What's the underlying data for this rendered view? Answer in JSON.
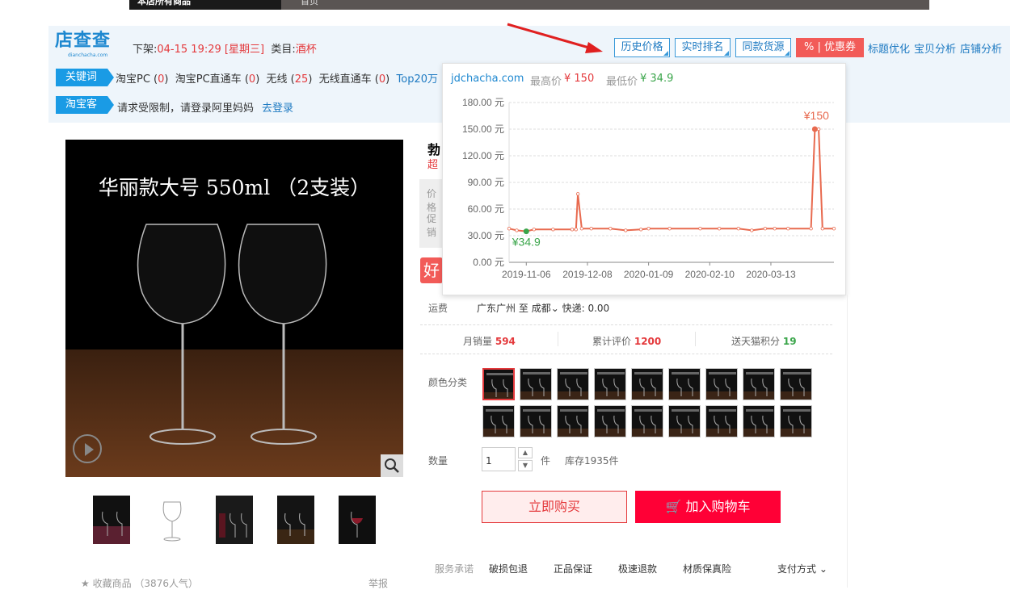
{
  "topbar": {
    "left_text": "本店所有商品",
    "right_text": "首页"
  },
  "plugin": {
    "logo_text": "店查查",
    "logo_sub": "dianchacha.com",
    "offline_label": "下架:",
    "offline_time": "04-15 19:29 [星期三]",
    "category_label": "类目:",
    "category_value": "酒杯",
    "buttons": {
      "history_price": "历史价格",
      "realtime_rank": "实时排名",
      "same_source": "同款货源",
      "coupon": "% | 优惠券"
    },
    "links": {
      "title_opt": "标题优化",
      "item_analysis": "宝贝分析",
      "shop_analysis": "店铺分析"
    },
    "keyword_tag": "关键词",
    "keywords": [
      {
        "label": "淘宝PC",
        "count": "0"
      },
      {
        "label": "淘宝PC直通车",
        "count": "0"
      },
      {
        "label": "无线",
        "count": "25"
      },
      {
        "label": "无线直通车",
        "count": "0"
      }
    ],
    "top_link": "Top20万",
    "taobaoke_tag": "淘宝客",
    "taobaoke_msg": "请求受限制，请登录阿里妈妈",
    "login_link": "去登录"
  },
  "popup": {
    "site": "jdchacha.com",
    "max_label": "最高价",
    "max_value": "¥ 150",
    "min_label": "最低价",
    "min_value": "¥ 34.9"
  },
  "chart_data": {
    "type": "line",
    "y_ticks": [
      "0.00 元",
      "30.00 元",
      "60.00 元",
      "90.00 元",
      "120.00 元",
      "150.00 元",
      "180.00 元"
    ],
    "x_ticks": [
      "2019-11-06",
      "2019-12-08",
      "2020-01-09",
      "2020-02-10",
      "2020-03-13"
    ],
    "ylim": [
      0,
      180
    ],
    "x": [
      "2019-10-28",
      "2019-11-01",
      "2019-11-06",
      "2019-11-10",
      "2019-11-20",
      "2019-11-30",
      "2019-12-02",
      "2019-12-03",
      "2019-12-05",
      "2019-12-10",
      "2019-12-20",
      "2019-12-28",
      "2020-01-05",
      "2020-01-09",
      "2020-01-20",
      "2020-02-05",
      "2020-02-15",
      "2020-02-25",
      "2020-03-03",
      "2020-03-10",
      "2020-03-15",
      "2020-03-22",
      "2020-04-03",
      "2020-04-05",
      "2020-04-07",
      "2020-04-09",
      "2020-04-15"
    ],
    "values": [
      38,
      36,
      34.9,
      37,
      37,
      37,
      37,
      77,
      38,
      38,
      38,
      36,
      37,
      38,
      38,
      38,
      38,
      38,
      36,
      38,
      38,
      38,
      38,
      150,
      150,
      38,
      38
    ],
    "grid": true,
    "annotations": [
      {
        "text": "¥150",
        "x": "2020-04-05",
        "y": 150
      },
      {
        "text": "¥34.9",
        "x": "2019-11-06",
        "y": 34.9
      }
    ],
    "colors": {
      "line": "#e86a4f",
      "max_label": "#e86a4f",
      "min_label": "#3aa54a"
    }
  },
  "product": {
    "title_fragment": "勃",
    "subtitle_fragment": "超",
    "image_caption": "华丽款大号 550ml （2支装）",
    "price_label": "价格",
    "promo_label": "促销",
    "hao_badge": "好",
    "shipping_label": "运费",
    "shipping_from": "广东广州",
    "shipping_to_label": "至",
    "shipping_to": "成都",
    "shipping_fee": "快递: 0.00",
    "stats": [
      {
        "label": "月销量",
        "value": "594"
      },
      {
        "label": "累计评价",
        "value": "1200"
      },
      {
        "label": "送天猫积分",
        "value": "19"
      }
    ],
    "color_label": "颜色分类",
    "qty_label": "数量",
    "qty_value": "1",
    "qty_unit": "件",
    "stock": "库存1935件",
    "buy_now": "立即购买",
    "add_cart": "加入购物车",
    "service_label": "服务承诺",
    "services": [
      "破损包退",
      "正品保证",
      "极速退款",
      "材质保真险"
    ],
    "payment": "支付方式",
    "favorite": "收藏商品",
    "favorite_count": "（3876人气）",
    "report": "举报"
  }
}
